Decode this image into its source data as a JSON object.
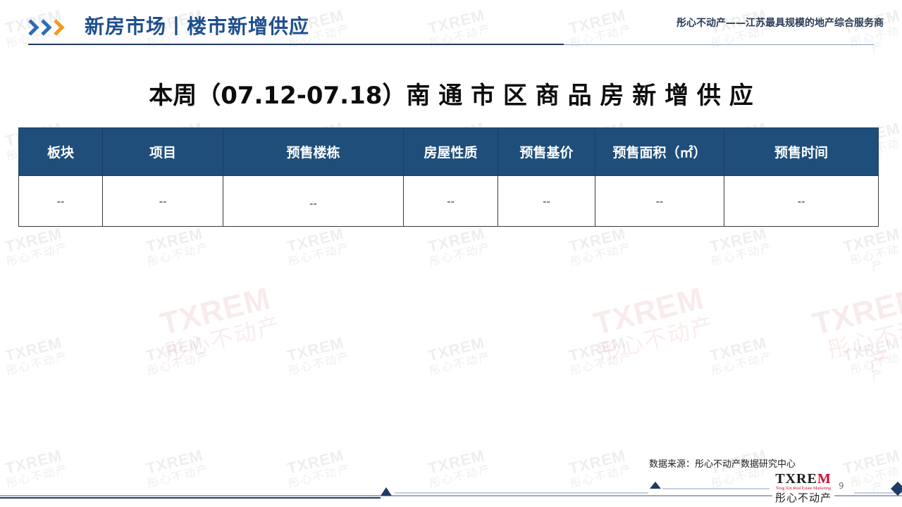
{
  "header": {
    "title": "新房市场丨楼市新增供应",
    "slogan": "彤心不动产——江苏最具规模的地产综合服务商"
  },
  "main": {
    "title": "本周（07.12-07.18）南 通 市 区 商 品 房 新 增 供 应"
  },
  "table": {
    "columns": [
      "板块",
      "项目",
      "预售楼栋",
      "房屋性质",
      "预售基价",
      "预售面积（㎡）",
      "预售时间"
    ],
    "rows": [
      [
        "--",
        "--",
        "--",
        "--",
        "--",
        "--",
        "--"
      ]
    ]
  },
  "footer": {
    "source": "数据来源：彤心不动产数据研究中心",
    "logo_text": "TXREM",
    "logo_sub": "Tong Xin Real Estate Marketing",
    "logo_cn": "彤心不动产",
    "page_number": "9"
  },
  "watermark": {
    "text_en": "TXREM",
    "text_cn": "彤心不动产"
  },
  "colors": {
    "header_blue": "#1f4e8c",
    "table_header": "#1f4e7a",
    "chevron_blue": "#2e6db4",
    "chevron_orange": "#f39a1e",
    "logo_red": "#c8102e"
  }
}
